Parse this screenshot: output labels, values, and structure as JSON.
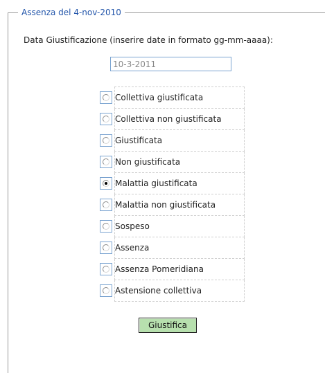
{
  "legend": "Assenza del 4-nov-2010",
  "prompt": "Data Giustificazione (inserire date in formato gg-mm-aaaa):",
  "date_field": {
    "value": "10-3-2011"
  },
  "options": [
    {
      "label": "Collettiva giustificata",
      "checked": false
    },
    {
      "label": "Collettiva non giustificata",
      "checked": false
    },
    {
      "label": "Giustificata",
      "checked": false
    },
    {
      "label": "Non giustificata",
      "checked": false
    },
    {
      "label": "Malattia giustificata",
      "checked": true
    },
    {
      "label": "Malattia non giustificata",
      "checked": false
    },
    {
      "label": "Sospeso",
      "checked": false
    },
    {
      "label": "Assenza",
      "checked": false
    },
    {
      "label": "Assenza Pomeridiana",
      "checked": false
    },
    {
      "label": "Astensione collettiva",
      "checked": false
    }
  ],
  "submit_label": "Giustifica",
  "colors": {
    "legend_text": "#2255aa",
    "field_border": "#7aa3d0",
    "button_bg": "#b7e0ae"
  }
}
